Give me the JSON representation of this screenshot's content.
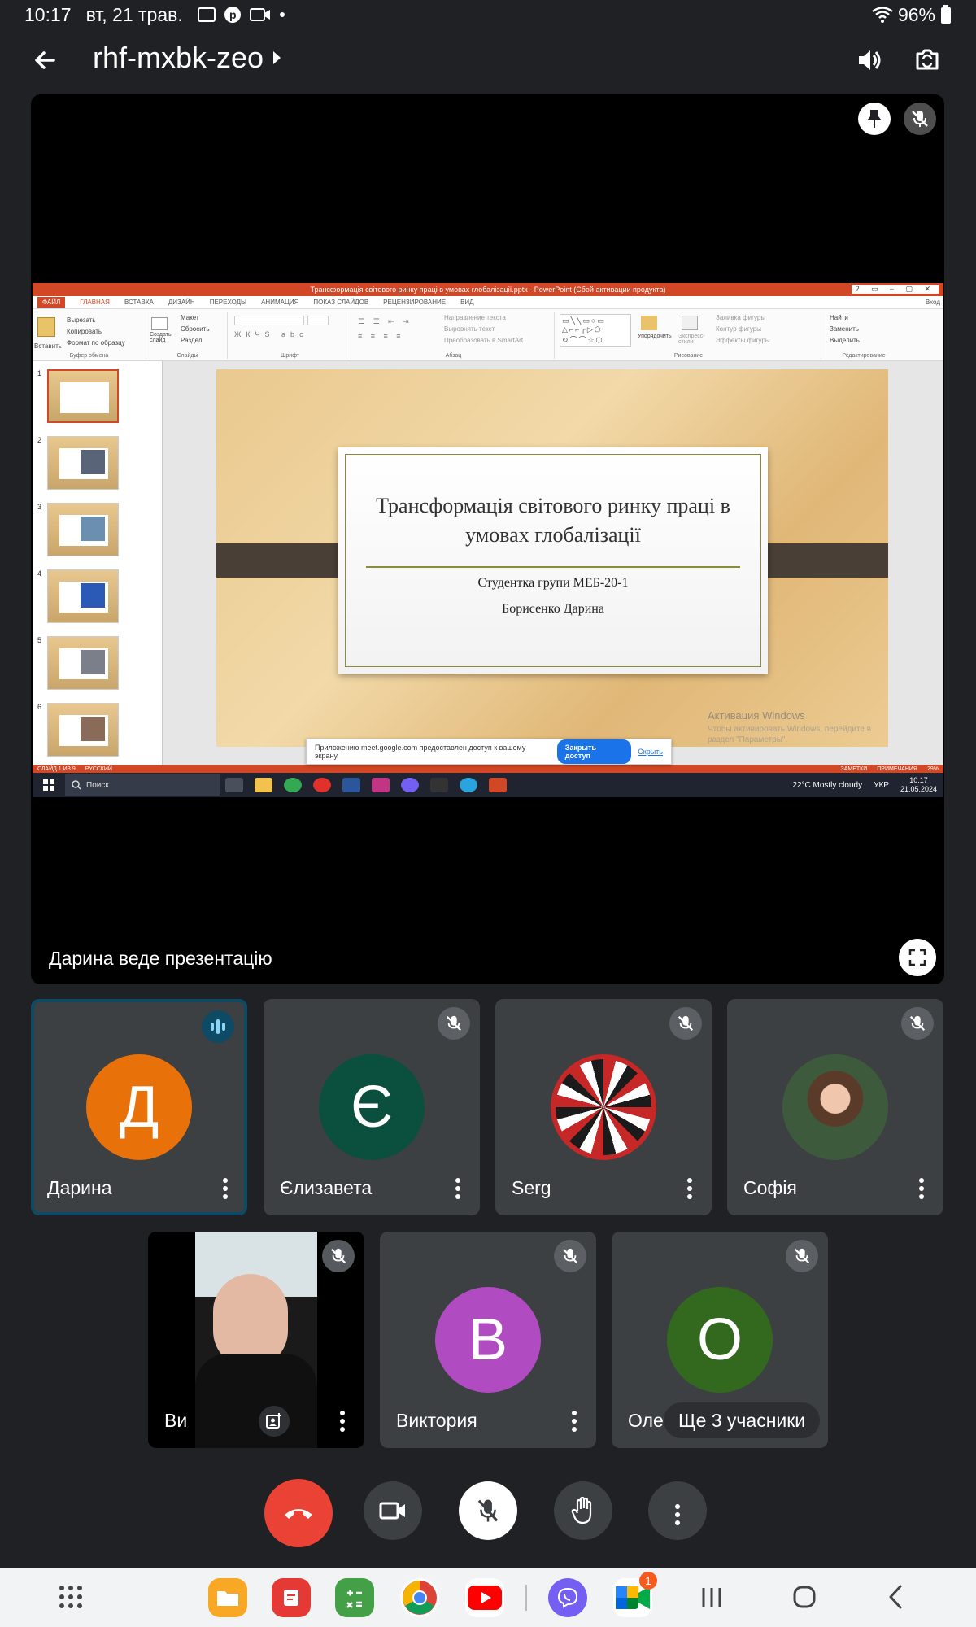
{
  "status_bar": {
    "time": "10:17",
    "date": "вт, 21 трав.",
    "battery": "96%"
  },
  "header": {
    "meeting_code": "rhf-mxbk-zeo"
  },
  "stage": {
    "presenter_label": "Дарина веде презентацію"
  },
  "shared_screen": {
    "window_title": "Трансформація світового ринку праці в умовах глобалізації.pptx - PowerPoint (Сбой активации продукта)",
    "tabs": [
      "ФАЙЛ",
      "ГЛАВНАЯ",
      "ВСТАВКА",
      "ДИЗАЙН",
      "ПЕРЕХОДЫ",
      "АНИМАЦИЯ",
      "ПОКАЗ СЛАЙДОВ",
      "РЕЦЕНЗИРОВАНИЕ",
      "ВИД"
    ],
    "sign_in": "Вход",
    "ribbon": {
      "clipboard": {
        "paste": "Вставить",
        "cut": "Вырезать",
        "copy": "Копировать",
        "format": "Формат по образцу",
        "label": "Буфер обмена"
      },
      "slides": {
        "new": "Создать слайд",
        "layout": "Макет",
        "reset": "Сбросить",
        "section": "Раздел",
        "label": "Слайды"
      },
      "font": {
        "label": "Шрифт"
      },
      "paragraph": {
        "dir": "Направление текста",
        "align": "Выровнять текст",
        "smartart": "Преобразовать в SmartArt",
        "label": "Абзац"
      },
      "drawing": {
        "arrange": "Упорядочить",
        "styles": "Экспресс-стили",
        "fill": "Заливка фигуры",
        "outline": "Контур фигуры",
        "effects": "Эффекты фигуры",
        "label": "Рисование"
      },
      "editing": {
        "find": "Найти",
        "replace": "Заменить",
        "select": "Выделить",
        "label": "Редактирование"
      }
    },
    "thumb_numbers": [
      "1",
      "2",
      "3",
      "4",
      "5",
      "6"
    ],
    "slide": {
      "title": "Трансформація світового ринку праці в умовах глобалізації",
      "line1": "Студентка групи МЕБ-20-1",
      "line2": "Борисенко Дарина"
    },
    "activation": {
      "title": "Активация Windows",
      "text": "Чтобы активировать Windows, перейдите в раздел \"Параметры\"."
    },
    "share_notice": {
      "text": "Приложению meet.google.com предоставлен доступ к вашему экрану.",
      "stop": "Закрыть доступ",
      "hide": "Скрыть"
    },
    "statusbar": {
      "slide": "СЛАЙД 1 ИЗ 9",
      "lang": "РУССКИЙ",
      "notes": "ЗАМЕТКИ",
      "comments": "ПРИМЕЧАНИЯ",
      "zoom": "29%"
    },
    "taskbar": {
      "search": "Поиск",
      "weather": "22°C  Mostly cloudy",
      "lang": "УКР",
      "clock_time": "10:17",
      "clock_date": "21.05.2024"
    }
  },
  "participants": [
    {
      "name": "Дарина",
      "initial": "Д",
      "color": "#e8710a"
    },
    {
      "name": "Єлизавета",
      "initial": "Є",
      "color": "#0b4f3f"
    },
    {
      "name": "Serg"
    },
    {
      "name": "Софія"
    },
    {
      "name": "Ви"
    },
    {
      "name": "Виктория",
      "initial": "В",
      "color": "#b14bc1"
    },
    {
      "name": "Оле",
      "initial": "О",
      "color": "#33691e"
    }
  ],
  "more_participants": "Ще 3 учасники",
  "nav": {
    "meet_badge": "1"
  },
  "colors": {
    "hangup": "#ea4335",
    "powerpoint": "#d24726",
    "tile_bg": "#3c4043"
  }
}
